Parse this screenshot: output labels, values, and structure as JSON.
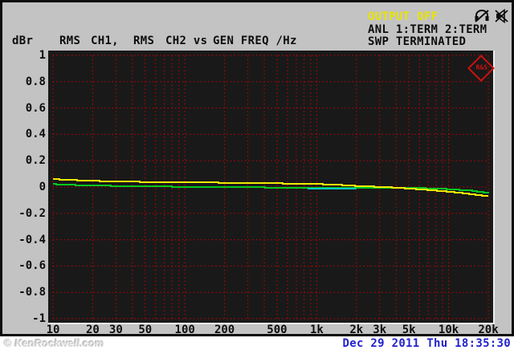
{
  "window": {
    "status": {
      "output_label": "OUTPUT OFF",
      "analyzer_line": "ANL 1:TERM 2:TERM",
      "sweep_line": "SWP TERMINATED"
    },
    "unit_label": "dBr",
    "header_parts": [
      "RMS",
      "CH1,",
      "RMS",
      "CH2 vs",
      "GEN FREQ /Hz"
    ],
    "icons": [
      "headphones-muted-icon",
      "speaker-muted-icon"
    ],
    "logo_text": "R&S"
  },
  "footer": {
    "watermark": "© KenRockwell.com",
    "datetime": "Dec 29 2011 Thu 18:35:30"
  },
  "chart_data": {
    "type": "line",
    "title": "RMS CH1, RMS CH2 vs GEN FREQ /Hz",
    "xlabel": "GEN FREQ /Hz",
    "ylabel": "dBr",
    "x_scale": "log",
    "xlim": [
      10,
      20000
    ],
    "ylim": [
      -1,
      1
    ],
    "grid": {
      "color": "#d40000",
      "style": "dotted",
      "minor_log_lines": true
    },
    "background": "#191919",
    "y_ticks": [
      {
        "v": 1.0,
        "label": "1"
      },
      {
        "v": 0.8,
        "label": "0.8"
      },
      {
        "v": 0.6,
        "label": "0.6"
      },
      {
        "v": 0.4,
        "label": "0.4"
      },
      {
        "v": 0.2,
        "label": "0.2"
      },
      {
        "v": 0.0,
        "label": "0"
      },
      {
        "v": -0.2,
        "label": "-0.2"
      },
      {
        "v": -0.4,
        "label": "-0.4"
      },
      {
        "v": -0.6,
        "label": "-0.6"
      },
      {
        "v": -0.8,
        "label": "-0.8"
      },
      {
        "v": -1.0,
        "label": "-1"
      }
    ],
    "x_ticks": [
      {
        "f": 10,
        "label": "10"
      },
      {
        "f": 20,
        "label": "20"
      },
      {
        "f": 30,
        "label": "30"
      },
      {
        "f": 50,
        "label": "50"
      },
      {
        "f": 100,
        "label": "100"
      },
      {
        "f": 200,
        "label": "200"
      },
      {
        "f": 500,
        "label": "500"
      },
      {
        "f": 1000,
        "label": "1k"
      },
      {
        "f": 2000,
        "label": "2k"
      },
      {
        "f": 3000,
        "label": "3k"
      },
      {
        "f": 5000,
        "label": "5k"
      },
      {
        "f": 10000,
        "label": "10k"
      },
      {
        "f": 20000,
        "label": "20k"
      }
    ],
    "series": [
      {
        "name": "RMS CH2",
        "color": "#00c81e",
        "width": 2,
        "points": [
          [
            10,
            0.022
          ],
          [
            15,
            0.015
          ],
          [
            20,
            0.012
          ],
          [
            30,
            0.008
          ],
          [
            50,
            0.005
          ],
          [
            100,
            0.002
          ],
          [
            200,
            0.0
          ],
          [
            500,
            -0.004
          ],
          [
            1000,
            -0.006
          ],
          [
            2000,
            -0.006
          ],
          [
            3000,
            -0.004
          ],
          [
            5000,
            -0.006
          ],
          [
            7000,
            -0.01
          ],
          [
            10000,
            -0.016
          ],
          [
            15000,
            -0.028
          ],
          [
            20000,
            -0.046
          ]
        ]
      },
      {
        "name": "RMS CH1",
        "color": "#f0ec00",
        "width": 2,
        "points": [
          [
            10,
            0.06
          ],
          [
            15,
            0.052
          ],
          [
            20,
            0.047
          ],
          [
            30,
            0.042
          ],
          [
            50,
            0.039
          ],
          [
            100,
            0.036
          ],
          [
            200,
            0.033
          ],
          [
            300,
            0.031
          ],
          [
            500,
            0.028
          ],
          [
            700,
            0.026
          ],
          [
            1000,
            0.023
          ],
          [
            1500,
            0.016
          ],
          [
            2000,
            0.008
          ],
          [
            3000,
            0.001
          ],
          [
            4000,
            -0.005
          ],
          [
            5000,
            -0.012
          ],
          [
            7000,
            -0.022
          ],
          [
            10000,
            -0.035
          ],
          [
            15000,
            -0.055
          ],
          [
            20000,
            -0.07
          ]
        ]
      },
      {
        "name": "cursor segment",
        "color": "#00c8c8",
        "width": 2,
        "points": [
          [
            850,
            -0.015
          ],
          [
            2000,
            -0.015
          ]
        ]
      }
    ]
  }
}
